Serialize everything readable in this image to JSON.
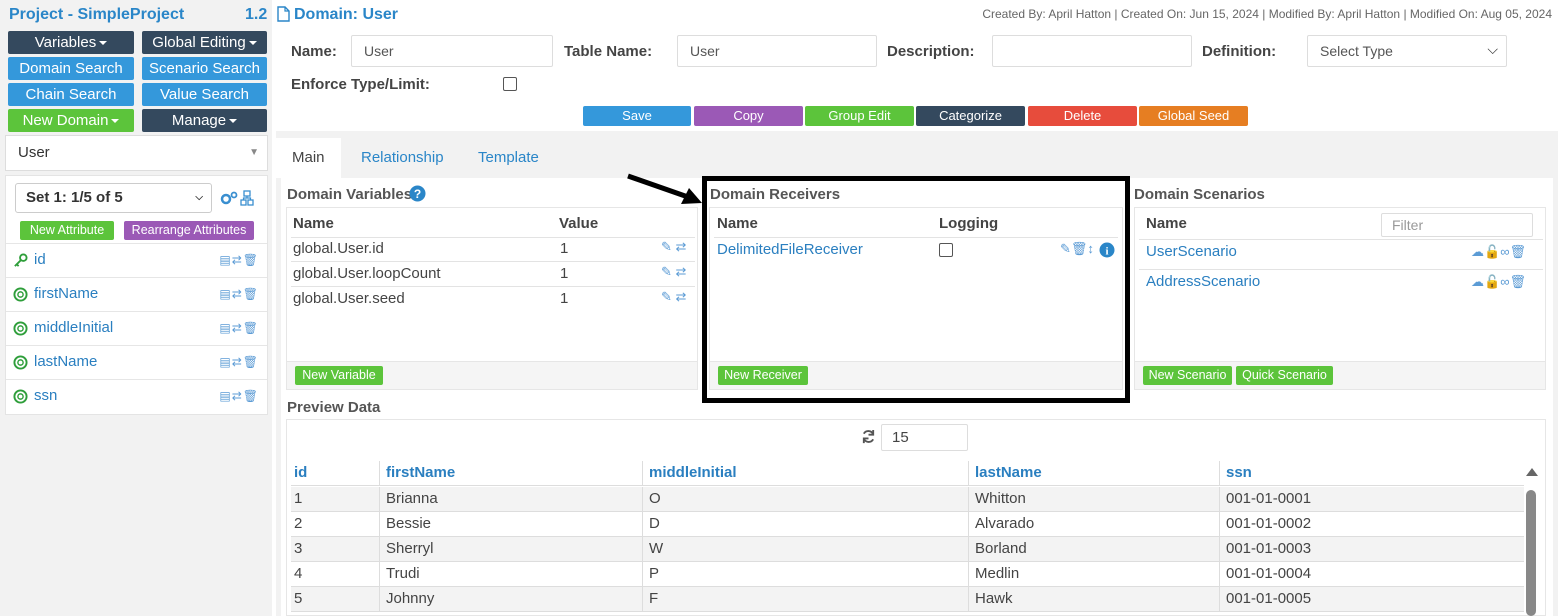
{
  "project": {
    "title": "Project - SimpleProject",
    "version": "1.2"
  },
  "sidebar": {
    "buttons": {
      "variables": "Variables",
      "global_editing": "Global Editing",
      "domain_search": "Domain Search",
      "scenario_search": "Scenario Search",
      "chain_search": "Chain Search",
      "value_search": "Value Search",
      "new_domain": "New Domain",
      "manage": "Manage"
    },
    "domain_selected": "User",
    "set_selected": "Set 1: 1/5 of 5",
    "new_attribute": "New Attribute",
    "rearrange_attributes": "Rearrange Attributes",
    "attributes": [
      {
        "name": "id",
        "icon": "key-icon"
      },
      {
        "name": "firstName",
        "icon": "lifebuoy-icon"
      },
      {
        "name": "middleInitial",
        "icon": "lifebuoy-icon"
      },
      {
        "name": "lastName",
        "icon": "lifebuoy-icon"
      },
      {
        "name": "ssn",
        "icon": "lifebuoy-icon"
      }
    ]
  },
  "header": {
    "domain_title": "Domain: User",
    "meta": "Created By: April Hatton | Created On: Jun 15, 2024 | Modified By: April Hatton | Modified On: Aug 05, 2024"
  },
  "form": {
    "name_label": "Name:",
    "name_value": "User",
    "table_name_label": "Table Name:",
    "table_name_value": "User",
    "description_label": "Description:",
    "description_value": "",
    "definition_label": "Definition:",
    "definition_value": "Select Type",
    "enforce_label": "Enforce Type/Limit:"
  },
  "actions": {
    "save": "Save",
    "copy": "Copy",
    "group_edit": "Group Edit",
    "categorize": "Categorize",
    "delete": "Delete",
    "global_seed": "Global Seed"
  },
  "tabs": [
    "Main",
    "Relationship",
    "Template"
  ],
  "variables": {
    "title": "Domain Variables",
    "col_name": "Name",
    "col_value": "Value",
    "rows": [
      {
        "name": "global.User.id",
        "value": "1"
      },
      {
        "name": "global.User.loopCount",
        "value": "1"
      },
      {
        "name": "global.User.seed",
        "value": "1"
      }
    ],
    "new_button": "New Variable"
  },
  "receivers": {
    "title": "Domain Receivers",
    "col_name": "Name",
    "col_logging": "Logging",
    "rows": [
      {
        "name": "DelimitedFileReceiver"
      }
    ],
    "new_button": "New Receiver"
  },
  "scenarios": {
    "title": "Domain Scenarios",
    "col_name": "Name",
    "filter_placeholder": "Filter",
    "rows": [
      {
        "name": "UserScenario"
      },
      {
        "name": "AddressScenario"
      }
    ],
    "new_button": "New Scenario",
    "quick_button": "Quick Scenario"
  },
  "preview": {
    "title": "Preview Data",
    "count": "15",
    "columns": [
      "id",
      "firstName",
      "middleInitial",
      "lastName",
      "ssn"
    ],
    "rows": [
      [
        "1",
        "Brianna",
        "O",
        "Whitton",
        "001-01-0001"
      ],
      [
        "2",
        "Bessie",
        "D",
        "Alvarado",
        "001-01-0002"
      ],
      [
        "3",
        "Sherryl",
        "W",
        "Borland",
        "001-01-0003"
      ],
      [
        "4",
        "Trudi",
        "P",
        "Medlin",
        "001-01-0004"
      ],
      [
        "5",
        "Johnny",
        "F",
        "Hawk",
        "001-01-0005"
      ]
    ]
  },
  "colors": {
    "brand_blue": "#2a86c8",
    "button_blue": "#3498db",
    "button_dark": "#34495e",
    "button_green": "#5cc43b",
    "button_purple": "#9b59b6",
    "button_red": "#e74c3c",
    "button_orange": "#e67e22"
  }
}
